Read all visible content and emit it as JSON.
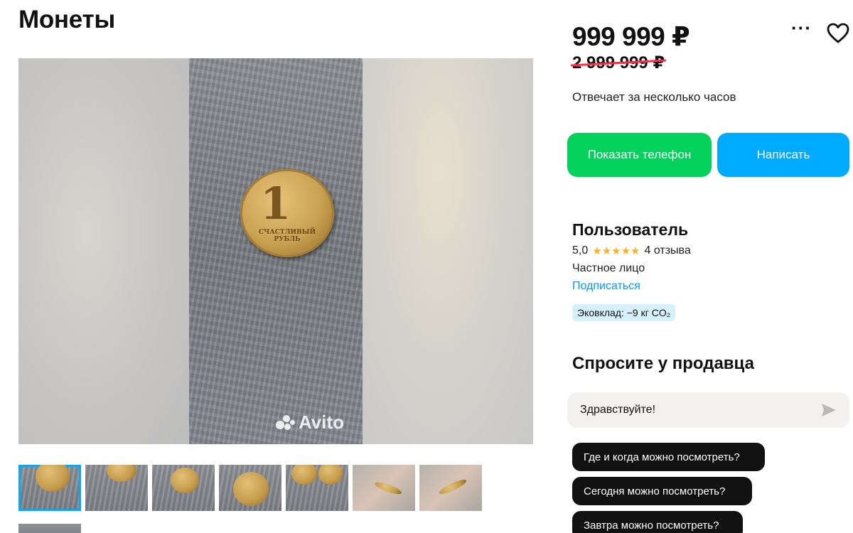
{
  "listing": {
    "title": "Монеты",
    "price": "999 999 ₽",
    "old_price": "2 999 999 ₽"
  },
  "seller_panel": {
    "response_time": "Отвечает за несколько часов",
    "show_phone_label": "Показать телефон",
    "write_label": "Написать",
    "name": "Пользователь",
    "rating": "5,0",
    "stars": "★★★★★",
    "reviews": "4 отзыва",
    "type": "Частное лицо",
    "subscribe_label": "Подписаться",
    "eco_badge": "Эковклад: −9 кг CO₂"
  },
  "ask_seller": {
    "title": "Спросите у продавца",
    "message_value": "Здравствуйте!",
    "quick_questions": [
      "Где и когда можно посмотреть?",
      "Сегодня можно посмотреть?",
      "Завтра можно посмотреть?"
    ]
  },
  "photo": {
    "coin_digit": "1",
    "coin_text": "СЧАСТЛИВЫЙ РУБЛЬ",
    "watermark": "Avito"
  },
  "icons": {
    "more": "more-dots-icon",
    "favorite": "heart-icon",
    "send": "send-arrow-icon"
  },
  "colors": {
    "phone_button": "#02d15c",
    "write_button": "#00aaff",
    "link": "#0099ff",
    "stars": "#ffb021",
    "eco_badge_bg": "#d7f0fd",
    "strike": "#ff2b4a"
  }
}
